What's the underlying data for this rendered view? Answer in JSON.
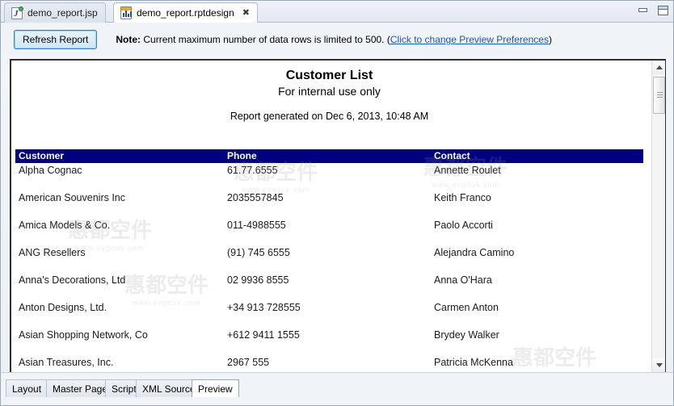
{
  "window": {
    "minimize_label": "Minimize",
    "maximize_label": "Maximize"
  },
  "editor_tabs": [
    {
      "label": "demo_report.jsp",
      "icon": "jsp-file-icon",
      "active": false
    },
    {
      "label": "demo_report.rptdesign",
      "icon": "rptdesign-file-icon",
      "active": true,
      "close_glyph": "✖"
    }
  ],
  "toolbar": {
    "refresh_label": "Refresh Report",
    "note_prefix": "Note:",
    "note_text": "Current maximum number of data rows is limited to 500.",
    "note_paren_open": "(",
    "note_link": "Click to change Preview Preferences",
    "note_paren_close": ")"
  },
  "report": {
    "title": "Customer List",
    "subtitle": "For internal use only",
    "generated": "Report generated on Dec 6, 2013, 10:48 AM",
    "columns": [
      "Customer",
      "Phone",
      "Contact"
    ],
    "rows": [
      {
        "customer": "Alpha Cognac",
        "phone": "61.77.6555",
        "contact": "Annette  Roulet"
      },
      {
        "customer": "American Souvenirs Inc",
        "phone": "2035557845",
        "contact": "Keith Franco"
      },
      {
        "customer": "Amica Models & Co.",
        "phone": "011-4988555",
        "contact": "Paolo  Accorti"
      },
      {
        "customer": "ANG Resellers",
        "phone": "(91) 745 6555",
        "contact": "Alejandra  Camino"
      },
      {
        "customer": "Anna's Decorations, Ltd",
        "phone": "02 9936 8555",
        "contact": "Anna O'Hara"
      },
      {
        "customer": "Anton Designs, Ltd.",
        "phone": "+34 913 728555",
        "contact": "Carmen Anton"
      },
      {
        "customer": "Asian Shopping Network, Co",
        "phone": "+612 9411 1555",
        "contact": "Brydey Walker"
      },
      {
        "customer": "Asian Treasures, Inc.",
        "phone": "2967 555",
        "contact": "Patricia  McKenna"
      }
    ],
    "header_bg": "#000080",
    "header_fg": "#ffffff"
  },
  "view_tabs": [
    {
      "label": "Layout",
      "active": false
    },
    {
      "label": "Master Page",
      "active": false
    },
    {
      "label": "Script",
      "active": false
    },
    {
      "label": "XML Source",
      "active": false
    },
    {
      "label": "Preview",
      "active": true
    }
  ],
  "watermark": {
    "text": "惠都空件",
    "url": "www.evgduk.com"
  },
  "colors": {
    "accent": "#000080",
    "link": "#1557c0",
    "button_border": "#2f84c8"
  }
}
